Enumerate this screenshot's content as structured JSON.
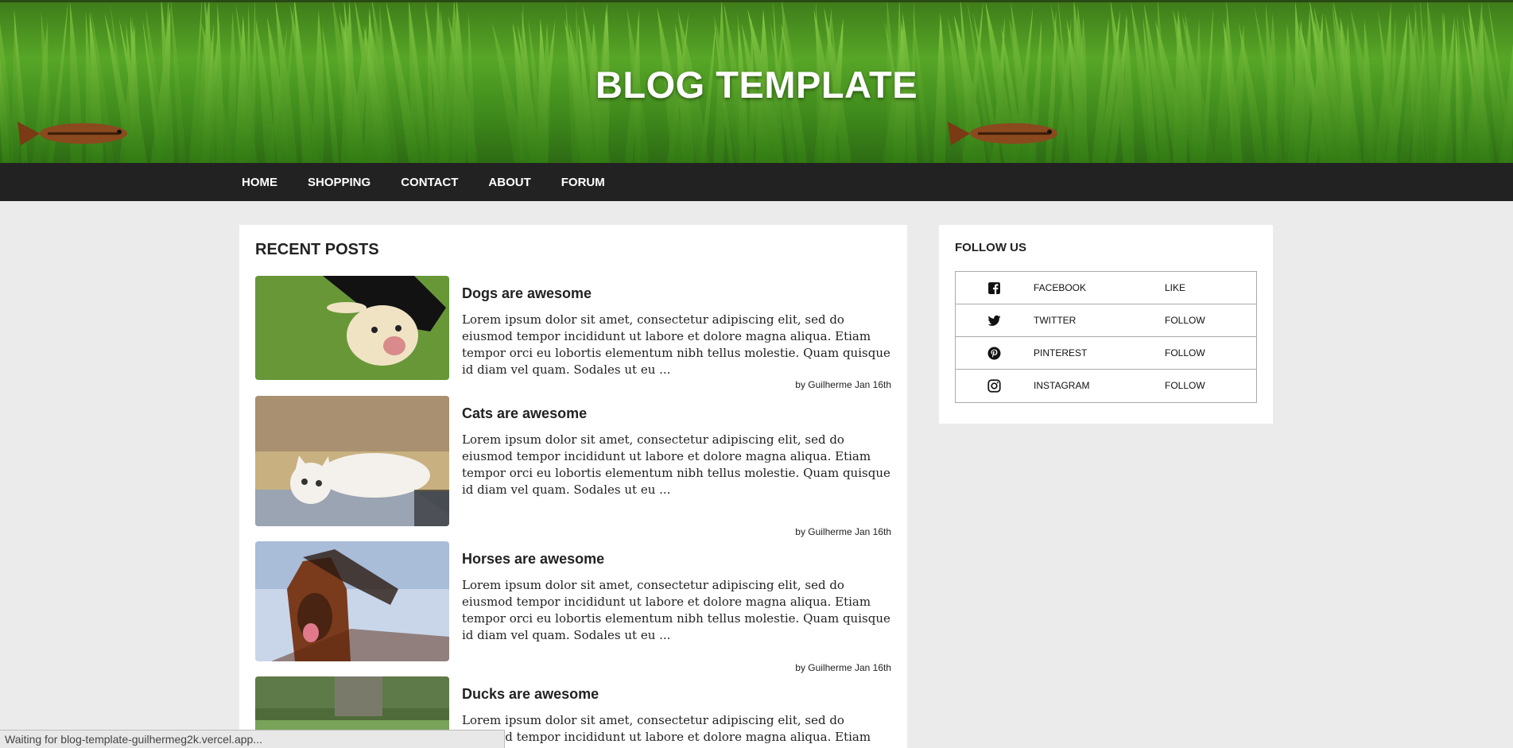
{
  "site": {
    "title": "BLOG TEMPLATE"
  },
  "nav": {
    "items": [
      "HOME",
      "SHOPPING",
      "CONTACT",
      "ABOUT",
      "FORUM"
    ]
  },
  "recent": {
    "heading": "RECENT POSTS",
    "posts": [
      {
        "title": "Dogs are awesome",
        "excerpt": "Lorem ipsum dolor sit amet, consectetur adipiscing elit, sed do eiusmod tempor incididunt ut labore et dolore magna aliqua. Etiam tempor orci eu lobortis elementum nibh tellus molestie. Quam quisque id diam vel quam. Sodales ut eu ...",
        "meta": "by Guilherme Jan 16th"
      },
      {
        "title": "Cats are awesome",
        "excerpt": "Lorem ipsum dolor sit amet, consectetur adipiscing elit, sed do eiusmod tempor incididunt ut labore et dolore magna aliqua. Etiam tempor orci eu lobortis elementum nibh tellus molestie. Quam quisque id diam vel quam. Sodales ut eu ...",
        "meta": "by Guilherme Jan 16th"
      },
      {
        "title": "Horses are awesome",
        "excerpt": "Lorem ipsum dolor sit amet, consectetur adipiscing elit, sed do eiusmod tempor incididunt ut labore et dolore magna aliqua. Etiam tempor orci eu lobortis elementum nibh tellus molestie. Quam quisque id diam vel quam. Sodales ut eu ...",
        "meta": "by Guilherme Jan 16th"
      },
      {
        "title": "Ducks are awesome",
        "excerpt": "Lorem ipsum dolor sit amet, consectetur adipiscing elit, sed do eiusmod tempor incididunt ut labore et dolore magna aliqua. Etiam tempor orci",
        "meta": ""
      }
    ]
  },
  "follow": {
    "heading": "FOLLOW US",
    "rows": [
      {
        "icon": "facebook-icon",
        "name": "FACEBOOK",
        "action": "LIKE"
      },
      {
        "icon": "twitter-icon",
        "name": "TWITTER",
        "action": "FOLLOW"
      },
      {
        "icon": "pinterest-icon",
        "name": "PINTEREST",
        "action": "FOLLOW"
      },
      {
        "icon": "instagram-icon",
        "name": "INSTAGRAM",
        "action": "FOLLOW"
      }
    ]
  },
  "status": {
    "text": "Waiting for blog-template-guilhermeg2k.vercel.app..."
  },
  "colors": {
    "nav_bg": "#222222",
    "page_bg": "#ebebeb",
    "banner_green": "#57a627"
  }
}
